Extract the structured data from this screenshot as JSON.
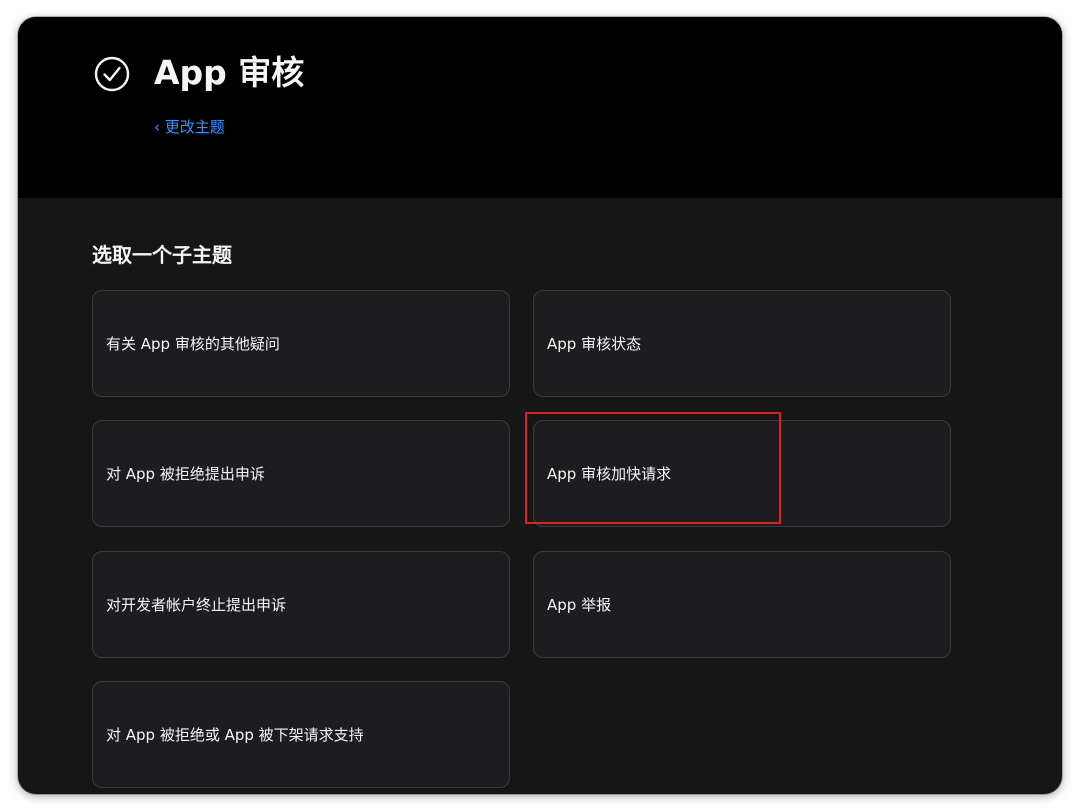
{
  "header": {
    "icon": "checkmark-circle-icon",
    "title": "App 审核",
    "back_link": "‹ 更改主题"
  },
  "main": {
    "heading": "选取一个子主题",
    "topics": [
      "有关 App 审核的其他疑问",
      "App 审核状态",
      "对 App 被拒绝提出申诉",
      "App 审核加快请求",
      "对开发者帐户终止提出申诉",
      "App 举报",
      "对 App 被拒绝或 App 被下架请求支持"
    ]
  },
  "colors": {
    "header_bg": "#000000",
    "page_bg": "#161616",
    "card_bg": "#1d1d1f",
    "card_border": "#3a3a3c",
    "link": "#2997ff",
    "highlight": "#e0201c"
  }
}
